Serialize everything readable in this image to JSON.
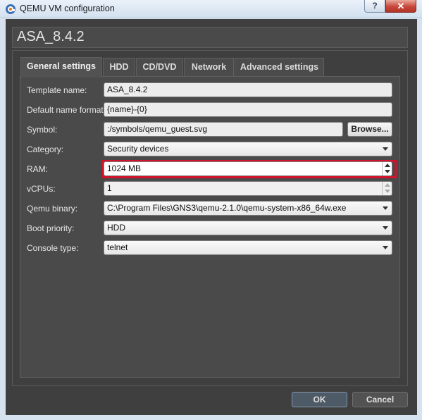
{
  "window": {
    "title": "QEMU VM configuration",
    "help_label": "?",
    "close_label": "✕"
  },
  "header": {
    "vm_name": "ASA_8.4.2"
  },
  "tabs": [
    {
      "label": "General settings",
      "active": true
    },
    {
      "label": "HDD"
    },
    {
      "label": "CD/DVD"
    },
    {
      "label": "Network"
    },
    {
      "label": "Advanced settings"
    }
  ],
  "form": {
    "template_name": {
      "label": "Template name:",
      "value": "ASA_8.4.2"
    },
    "default_name_format": {
      "label": "Default name format:",
      "value": "{name}-{0}"
    },
    "symbol": {
      "label": "Symbol:",
      "value": ":/symbols/qemu_guest.svg",
      "browse_label": "Browse..."
    },
    "category": {
      "label": "Category:",
      "value": "Security devices"
    },
    "ram": {
      "label": "RAM:",
      "value": "1024 MB"
    },
    "vcpus": {
      "label": "vCPUs:",
      "value": "1"
    },
    "qemu_binary": {
      "label": "Qemu binary:",
      "value": "C:\\Program Files\\GNS3\\qemu-2.1.0\\qemu-system-x86_64w.exe"
    },
    "boot_priority": {
      "label": "Boot priority:",
      "value": "HDD"
    },
    "console_type": {
      "label": "Console type:",
      "value": "telnet"
    }
  },
  "buttons": {
    "ok": "OK",
    "cancel": "Cancel"
  },
  "colors": {
    "highlight": "#d3132b",
    "panel": "#4a4a4a",
    "background": "#3f3f3f"
  }
}
